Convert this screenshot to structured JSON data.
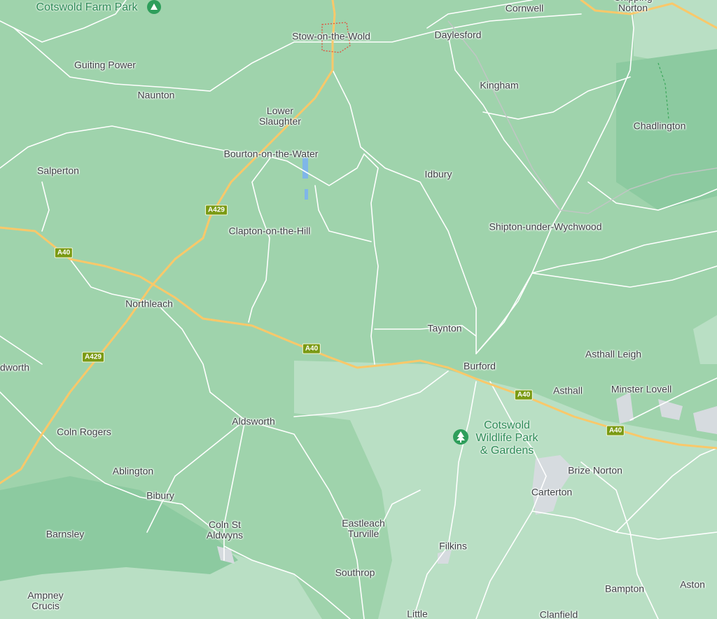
{
  "map": {
    "colors": {
      "land": "#9fd3ac",
      "forest": "#8ccaa0",
      "light": "#b9dfc4",
      "road": "#ffffff",
      "a_road": "#f9c86a",
      "urban": "#d6dbdf",
      "water": "#7fb6e8"
    },
    "places": [
      {
        "id": "stow",
        "label": "Stow-on-the-Wold"
      },
      {
        "id": "daylesford",
        "label": "Daylesford"
      },
      {
        "id": "cornwell",
        "label": "Cornwell"
      },
      {
        "id": "chipping-norton",
        "label": "Chipping\nNorton"
      },
      {
        "id": "guiting-power",
        "label": "Guiting Power"
      },
      {
        "id": "naunton",
        "label": "Naunton"
      },
      {
        "id": "kingham",
        "label": "Kingham"
      },
      {
        "id": "lower-slaughter",
        "label": "Lower\nSlaughter"
      },
      {
        "id": "chadlington",
        "label": "Chadlington"
      },
      {
        "id": "bourton",
        "label": "Bourton-on-the-Water"
      },
      {
        "id": "salperton",
        "label": "Salperton"
      },
      {
        "id": "idbury",
        "label": "Idbury"
      },
      {
        "id": "clapton",
        "label": "Clapton-on-the-Hill"
      },
      {
        "id": "shipton",
        "label": "Shipton-under-Wychwood"
      },
      {
        "id": "northleach",
        "label": "Northleach"
      },
      {
        "id": "taynton",
        "label": "Taynton"
      },
      {
        "id": "asthall-leigh",
        "label": "Asthall Leigh"
      },
      {
        "id": "burford",
        "label": "Burford"
      },
      {
        "id": "dworth",
        "label": "dworth"
      },
      {
        "id": "asthall",
        "label": "Asthall"
      },
      {
        "id": "minster-lovell",
        "label": "Minster Lovell"
      },
      {
        "id": "aldsworth",
        "label": "Aldsworth"
      },
      {
        "id": "coln-rogers",
        "label": "Coln Rogers"
      },
      {
        "id": "brize-norton",
        "label": "Brize Norton"
      },
      {
        "id": "ablington",
        "label": "Ablington"
      },
      {
        "id": "carterton",
        "label": "Carterton"
      },
      {
        "id": "bibury",
        "label": "Bibury"
      },
      {
        "id": "coln-st-aldwyns",
        "label": "Coln St\nAldwyns"
      },
      {
        "id": "eastleach",
        "label": "Eastleach\nTurville"
      },
      {
        "id": "barnsley",
        "label": "Barnsley"
      },
      {
        "id": "filkins",
        "label": "Filkins"
      },
      {
        "id": "southrop",
        "label": "Southrop"
      },
      {
        "id": "aston",
        "label": "Aston"
      },
      {
        "id": "bampton",
        "label": "Bampton"
      },
      {
        "id": "ampney-crucis",
        "label": "Ampney\nCrucis"
      },
      {
        "id": "little",
        "label": "Little"
      },
      {
        "id": "clanfield",
        "label": "Clanfield"
      }
    ],
    "pois": [
      {
        "id": "cotswold-farm-park",
        "label": "Cotswold Farm Park",
        "icon": "campsite-icon"
      },
      {
        "id": "cotswold-wildlife-park",
        "label": "Cotswold\nWildlife Park\n& Gardens",
        "icon": "tree-icon"
      }
    ],
    "shields": [
      "A429",
      "A40",
      "A429",
      "A40",
      "A40",
      "A40"
    ]
  }
}
